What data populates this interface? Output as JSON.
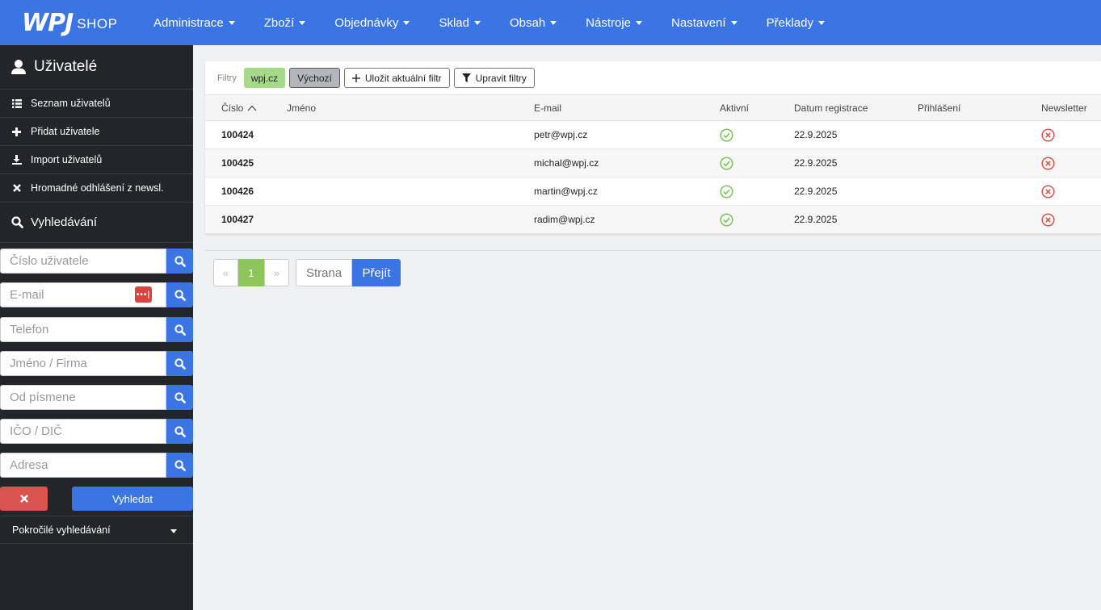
{
  "logo": {
    "brand": "WPJ",
    "sub": "SHOP"
  },
  "nav": [
    {
      "label": "Administrace"
    },
    {
      "label": "Zboží"
    },
    {
      "label": "Objednávky"
    },
    {
      "label": "Sklad"
    },
    {
      "label": "Obsah"
    },
    {
      "label": "Nástroje"
    },
    {
      "label": "Nastavení"
    },
    {
      "label": "Překlady"
    }
  ],
  "sidebar": {
    "title": "Uživatelé",
    "items": [
      {
        "label": "Seznam uživatelů",
        "icon": "list-icon"
      },
      {
        "label": "Přidat uživatele",
        "icon": "plus-icon"
      },
      {
        "label": "Import uživatelů",
        "icon": "import-icon"
      },
      {
        "label": "Hromadné odhlášení z newsl.",
        "icon": "close-icon"
      }
    ],
    "search_title": "Vyhledávání",
    "fields": [
      {
        "placeholder": "Číslo uživatele"
      },
      {
        "placeholder": "E-mail"
      },
      {
        "placeholder": "Telefon"
      },
      {
        "placeholder": "Jméno / Firma"
      },
      {
        "placeholder": "Od písmene"
      },
      {
        "placeholder": "IČO / DIČ"
      },
      {
        "placeholder": "Adresa"
      }
    ],
    "pw_badge": "•••|",
    "search_button": "Vyhledat",
    "advanced": "Pokročilé vyhledávání"
  },
  "filters": {
    "label": "Filtry",
    "chips": [
      "wpj.cz",
      "Výchozí"
    ],
    "save": "Uložit aktuální filtr",
    "edit": "Upravit filtry"
  },
  "table": {
    "columns": [
      "Číslo",
      "Jméno",
      "E-mail",
      "Aktivní",
      "Datum registrace",
      "Přihlášení",
      "Newsletter"
    ],
    "rows": [
      {
        "num": "100424",
        "name": "",
        "email": "petr@wpj.cz",
        "active": true,
        "date": "22.9.2025",
        "login": "",
        "newsletter": false
      },
      {
        "num": "100425",
        "name": "",
        "email": "michal@wpj.cz",
        "active": true,
        "date": "22.9.2025",
        "login": "",
        "newsletter": false
      },
      {
        "num": "100426",
        "name": "",
        "email": "martin@wpj.cz",
        "active": true,
        "date": "22.9.2025",
        "login": "",
        "newsletter": false
      },
      {
        "num": "100427",
        "name": "",
        "email": "radim@wpj.cz",
        "active": true,
        "date": "22.9.2025",
        "login": "",
        "newsletter": false
      }
    ]
  },
  "pager": {
    "prev": "«",
    "current": "1",
    "next": "»",
    "page_placeholder": "Strana",
    "go": "Přejít"
  },
  "colors": {
    "accent": "#3b74e3",
    "sidebar": "#23252a",
    "success": "#7cc35a",
    "danger": "#d9534f"
  }
}
